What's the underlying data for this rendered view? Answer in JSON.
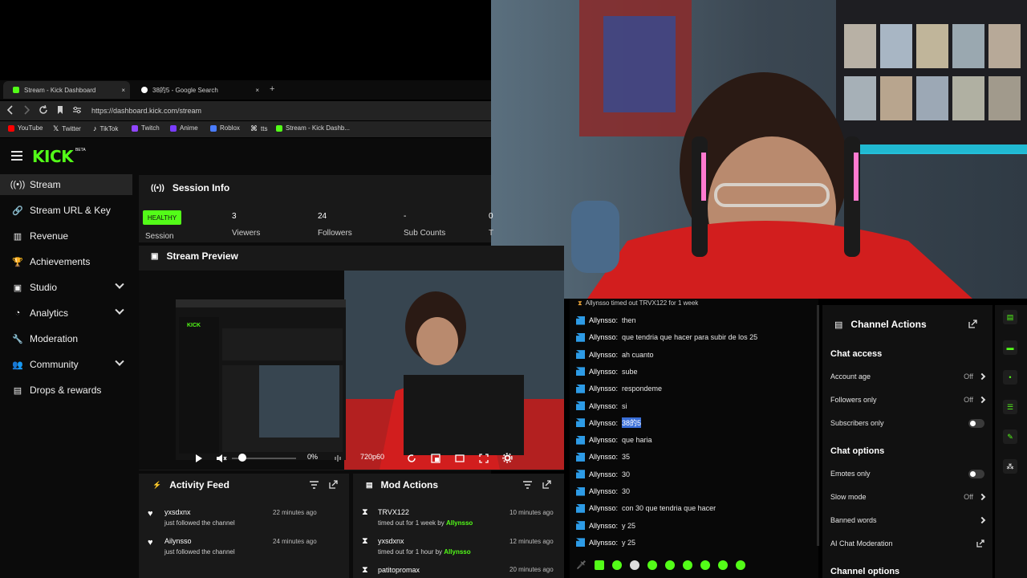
{
  "browser": {
    "tabs": [
      {
        "label": "Stream - Kick Dashboard",
        "close": "×"
      },
      {
        "label": "38的5 - Google Search",
        "close": "×"
      }
    ],
    "new_tab": "+",
    "url": "https://dashboard.kick.com/stream",
    "bookmarks": [
      {
        "label": "YouTube",
        "color": "#ff0000"
      },
      {
        "label": "Twitter",
        "color": "#ffffff"
      },
      {
        "label": "TikTok",
        "color": "#ffffff"
      },
      {
        "label": "Twitch",
        "color": "#9146ff"
      },
      {
        "label": "Anime",
        "color": "#7a3cff"
      },
      {
        "label": "Roblox",
        "color": "#4a7cff"
      },
      {
        "label": "tts",
        "color": "#ffffff"
      },
      {
        "label": "Stream - Kick Dashb...",
        "color": "#53fc18"
      }
    ]
  },
  "brand": {
    "logo": "KICK",
    "beta": "BETA",
    "accent": "#53fc18"
  },
  "sidebar": {
    "items": [
      {
        "label": "Stream",
        "icon": "stream-icon",
        "active": true
      },
      {
        "label": "Stream URL & Key",
        "icon": "link-icon"
      },
      {
        "label": "Revenue",
        "icon": "chart-icon"
      },
      {
        "label": "Achievements",
        "icon": "trophy-icon"
      },
      {
        "label": "Studio",
        "icon": "studio-icon",
        "expandable": true
      },
      {
        "label": "Analytics",
        "icon": "analytics-icon",
        "expandable": true
      },
      {
        "label": "Moderation",
        "icon": "wrench-icon"
      },
      {
        "label": "Community",
        "icon": "community-icon",
        "expandable": true
      },
      {
        "label": "Drops & rewards",
        "icon": "gift-icon"
      }
    ]
  },
  "session": {
    "title": "Session Info",
    "health": "HEALTHY",
    "health_label": "Session",
    "stats": [
      {
        "value": "3",
        "label": "Viewers"
      },
      {
        "value": "24",
        "label": "Followers"
      },
      {
        "value": "-",
        "label": "Sub Counts"
      },
      {
        "value": "0",
        "label": "T"
      }
    ]
  },
  "preview": {
    "title": "Stream Preview",
    "volume": "0%",
    "quality": "720p60"
  },
  "activity_feed": {
    "title": "Activity Feed",
    "items": [
      {
        "name": "yxsdxnx",
        "text": "just followed the channel",
        "time": "22 minutes ago"
      },
      {
        "name": "Ailynsso",
        "text": "just followed the channel",
        "time": "24 minutes ago"
      }
    ]
  },
  "mod_actions": {
    "title": "Mod Actions",
    "items": [
      {
        "name": "TRVX122",
        "text_pre": "timed out for 1 week by ",
        "by": "Allynsso",
        "time": "10 minutes ago"
      },
      {
        "name": "yxsdxnx",
        "text_pre": "timed out for 1 hour by ",
        "by": "Allynsso",
        "time": "12 minutes ago"
      },
      {
        "name": "patitopromax",
        "text_pre": "",
        "by": "",
        "time": "20 minutes ago"
      }
    ]
  },
  "chat": {
    "system": "Allynsso timed out TRVX122 for 1 week",
    "messages": [
      {
        "user": "Allynsso:",
        "text": "then"
      },
      {
        "user": "Allynsso:",
        "text": "que tendria que hacer para subir de los 25"
      },
      {
        "user": "Allynsso:",
        "text": "ah cuanto"
      },
      {
        "user": "Allynsso:",
        "text": "sube"
      },
      {
        "user": "Allynsso:",
        "text": "respondeme"
      },
      {
        "user": "Allynsso:",
        "text": "si"
      },
      {
        "user": "Allynsso:",
        "text": "38的5",
        "highlight": true
      },
      {
        "user": "Allynsso:",
        "text": "que haria"
      },
      {
        "user": "Allynsso:",
        "text": "35"
      },
      {
        "user": "Allynsso:",
        "text": "30"
      },
      {
        "user": "Allynsso:",
        "text": "30"
      },
      {
        "user": "Allynsso:",
        "text": "con 30 que tendria que hacer"
      },
      {
        "user": "Allynsso:",
        "text": "y 25"
      },
      {
        "user": "Allynsso:",
        "text": "y 25"
      }
    ]
  },
  "channel_actions": {
    "title": "Channel Actions",
    "chat_access": "Chat access",
    "account_age": {
      "label": "Account age",
      "value": "Off"
    },
    "followers_only": {
      "label": "Followers only",
      "value": "Off"
    },
    "subscribers_only": {
      "label": "Subscribers only"
    },
    "chat_options": "Chat options",
    "emotes_only": {
      "label": "Emotes only"
    },
    "slow_mode": {
      "label": "Slow mode",
      "value": "Off"
    },
    "banned_words": {
      "label": "Banned words"
    },
    "ai_mod": {
      "label": "AI Chat Moderation"
    },
    "channel_options": "Channel options"
  }
}
